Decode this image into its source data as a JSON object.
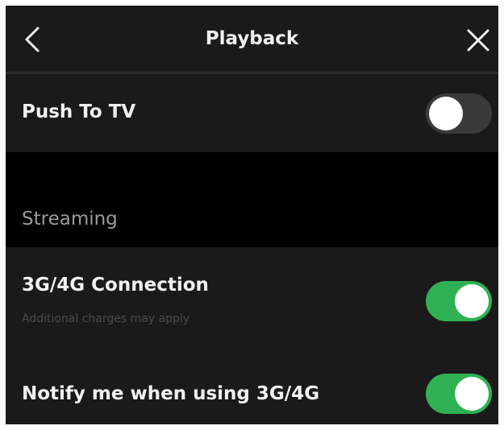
{
  "header": {
    "title": "Playback",
    "back_icon": "chevron-left-icon",
    "close_icon": "close-icon"
  },
  "push_to_tv": {
    "label": "Push To TV",
    "enabled": false
  },
  "streaming": {
    "section_label": "Streaming",
    "connection": {
      "label": "3G/4G Connection",
      "sublabel": "Additional charges may apply",
      "enabled": true
    },
    "notify": {
      "label": "Notify me when using 3G/4G",
      "enabled": true
    }
  },
  "colors": {
    "background": "#191919",
    "section_background": "#000000",
    "toggle_on": "#2fb153",
    "toggle_off": "#3a3a3a"
  }
}
